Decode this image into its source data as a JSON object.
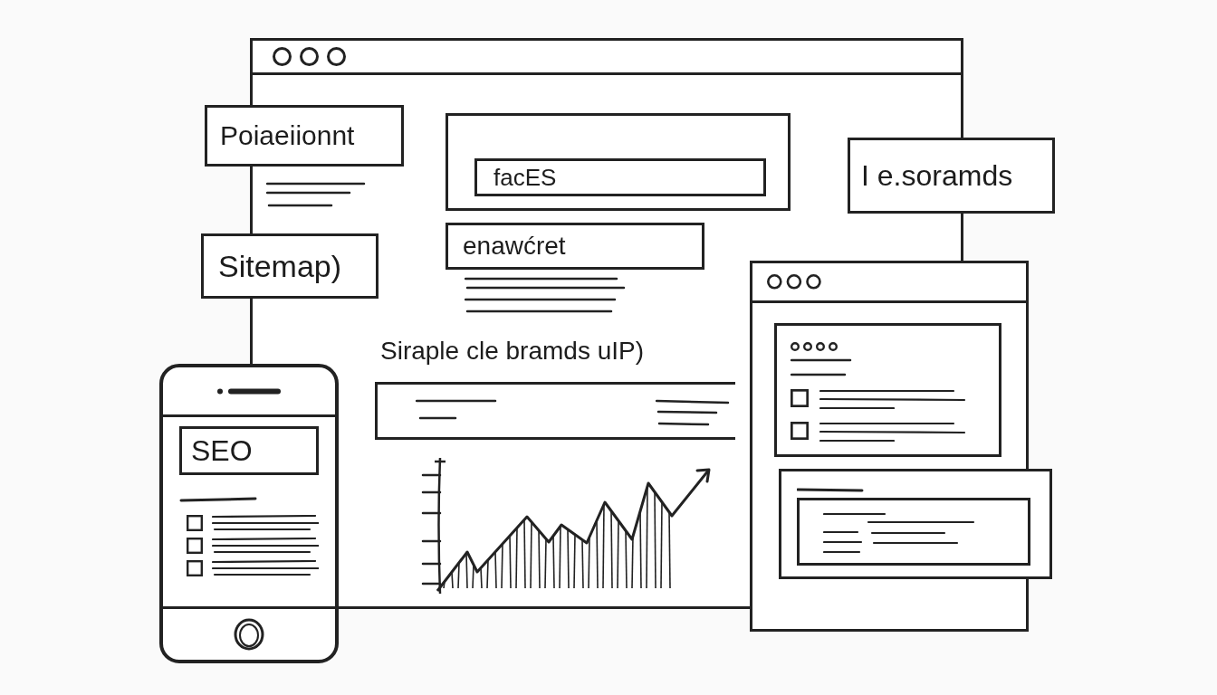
{
  "main_window": {
    "hero_card": {
      "field_value": "facES"
    },
    "section_heading": "enawćret",
    "page_title": "Siraple cle bramds uIP)"
  },
  "labels": [
    {
      "text": "Poiaeiionnt"
    },
    {
      "text": "Sitemap)"
    },
    {
      "text": "I e.soramds"
    }
  ],
  "phone": {
    "header": "SEO",
    "checklist": [
      {
        "checked": false
      },
      {
        "checked": false
      },
      {
        "checked": false
      }
    ]
  },
  "side_window": {
    "checklist": [
      {
        "checked": false
      },
      {
        "checked": false
      }
    ]
  }
}
